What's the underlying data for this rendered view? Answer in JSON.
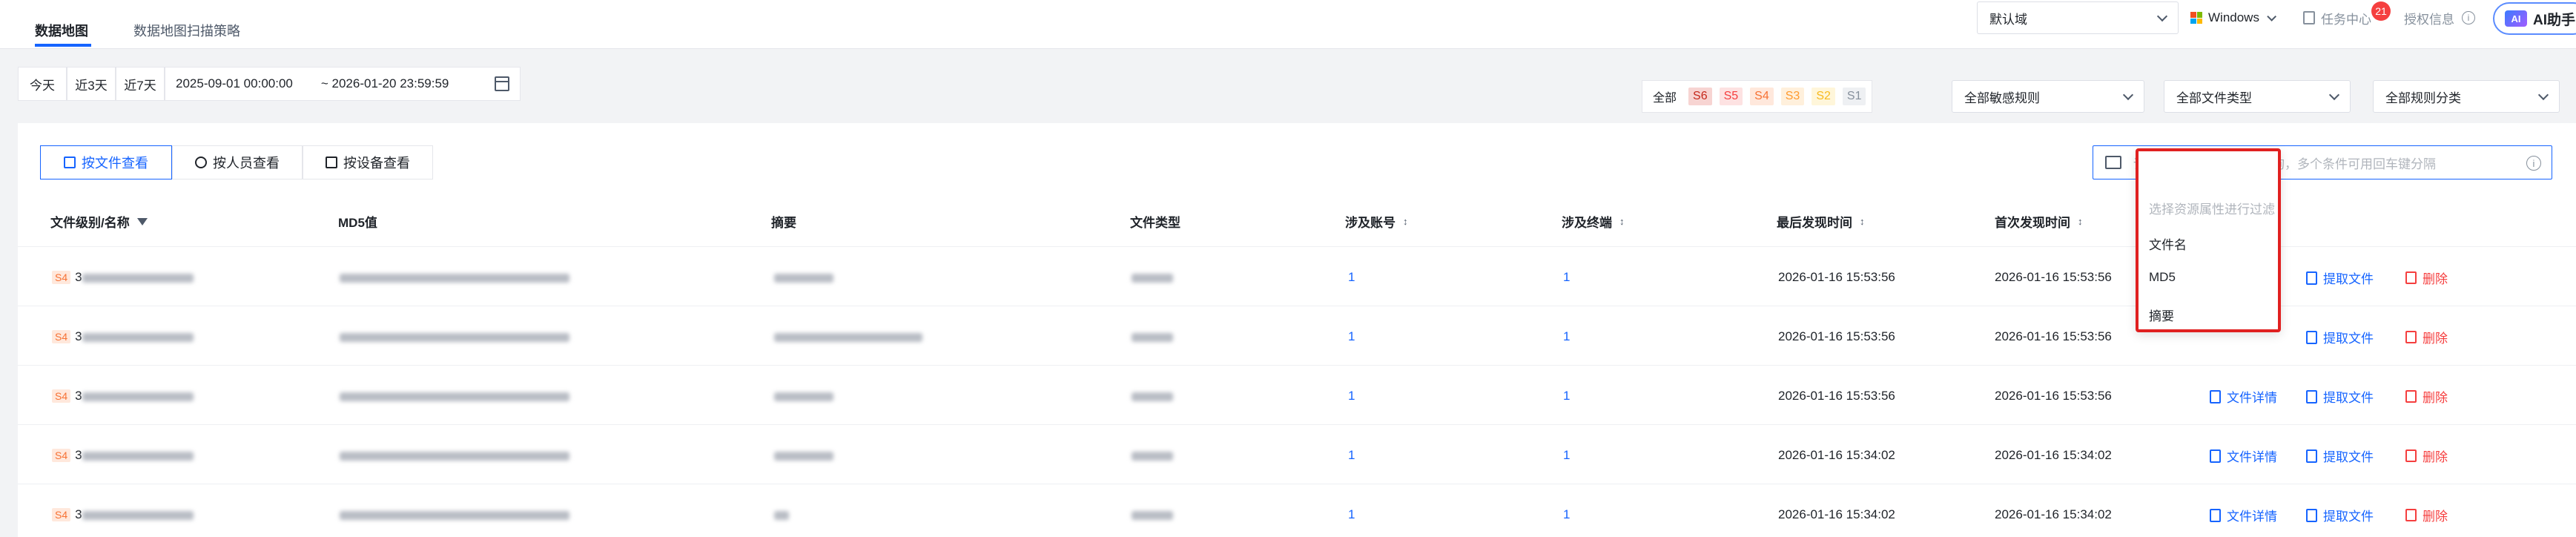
{
  "tabs": [
    "数据地图",
    "数据地图扫描策略"
  ],
  "header": {
    "domain_select": "默认域",
    "os_select": "Windows",
    "task_center": "任务中心",
    "task_badge": "21",
    "license": "授权信息",
    "ai_button": "AI助手",
    "ai_logo": "AI"
  },
  "quick_dates": [
    "今天",
    "近3天",
    "近7天"
  ],
  "date_range": {
    "start": "2025-09-01 00:00:00",
    "end": "~ 2026-01-20 23:59:59"
  },
  "levels": [
    "全部",
    "S6",
    "S5",
    "S4",
    "S3",
    "S2",
    "S1"
  ],
  "level_colors": [
    "#1f2329",
    "#c5281c",
    "#f53f3f",
    "#f77234",
    "#ff9a2e",
    "#f7ba1e",
    "#86909c"
  ],
  "filters": [
    "全部敏感规则",
    "全部文件类型",
    "全部规则分类"
  ],
  "view_tabs": [
    "按文件查看",
    "按人员查看",
    "按设备查看"
  ],
  "search": {
    "placeholder": "请输入关键字进行精准查询，多个条件可用回车键分隔"
  },
  "dropdown": {
    "hint": "选择资源属性进行过滤",
    "options": [
      "文件名",
      "MD5",
      "摘要"
    ]
  },
  "columns": [
    "文件级别/名称",
    "MD5值",
    "摘要",
    "文件类型",
    "涉及账号",
    "涉及终端",
    "最后发现时间",
    "首次发现时间"
  ],
  "rows": [
    {
      "level": "S4",
      "name_prefix": "3",
      "accounts": "1",
      "terminals": "1",
      "last_seen": "2026-01-16 15:53:56",
      "first_seen": "2026-01-16 15:53:56"
    },
    {
      "level": "S4",
      "name_prefix": "3",
      "accounts": "1",
      "terminals": "1",
      "last_seen": "2026-01-16 15:53:56",
      "first_seen": "2026-01-16 15:53:56"
    },
    {
      "level": "S4",
      "name_prefix": "3",
      "accounts": "1",
      "terminals": "1",
      "last_seen": "2026-01-16 15:53:56",
      "first_seen": "2026-01-16 15:53:56"
    },
    {
      "level": "S4",
      "name_prefix": "3",
      "accounts": "1",
      "terminals": "1",
      "last_seen": "2026-01-16 15:34:02",
      "first_seen": "2026-01-16 15:34:02"
    },
    {
      "level": "S4",
      "name_prefix": "3",
      "accounts": "1",
      "terminals": "1",
      "last_seen": "2026-01-16 15:34:02",
      "first_seen": "2026-01-16 15:34:02"
    }
  ],
  "actions": {
    "detail": "文件详情",
    "extract": "提取文件",
    "delete": "删除"
  }
}
